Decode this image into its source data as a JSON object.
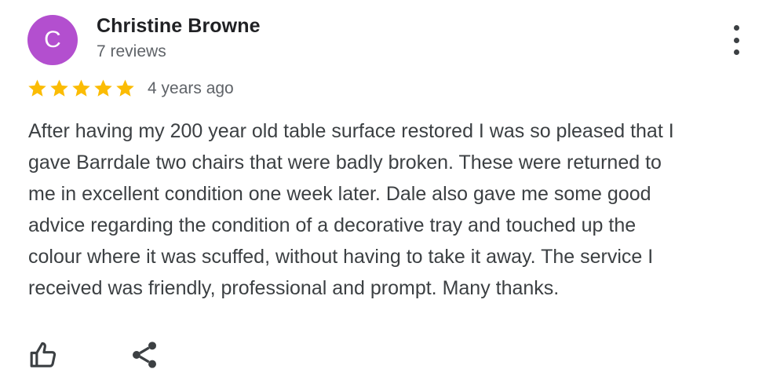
{
  "reviewer": {
    "avatar_letter": "C",
    "avatar_color": "#b34fcf",
    "name": "Christine Browne",
    "review_count": "7 reviews"
  },
  "review": {
    "rating": 5,
    "rating_max": 5,
    "star_color": "#fbbc04",
    "time_ago": "4 years ago",
    "text_lines": [
      "After having my 200 year old table surface restored I was so pleased that I",
      "gave Barrdale two chairs that were badly broken. These were returned to",
      "me in excellent condition one week later. Dale also gave me some good",
      "advice regarding the condition of a decorative tray and touched up the",
      "colour where it was scuffed, without having to take it away. The service I",
      "received was friendly, professional and prompt. Many thanks."
    ]
  },
  "actions": {
    "more_icon": "more-vert-icon",
    "like_icon": "thumb-up-icon",
    "share_icon": "share-icon"
  }
}
